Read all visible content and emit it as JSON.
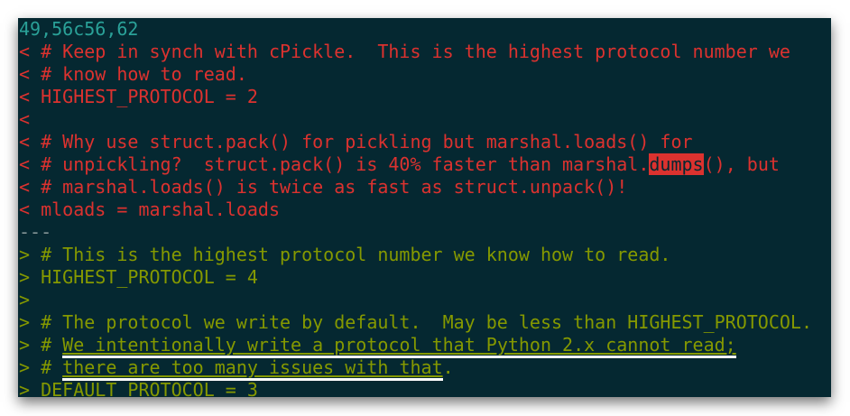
{
  "colors": {
    "background": "#052831",
    "hunk": "#2aa198",
    "deleted": "#dc322f",
    "added": "#859900",
    "separator": "#839496"
  },
  "diff": {
    "hunk_header": "49,56c56,62",
    "deleted": [
      {
        "text": "< # Keep in synch with cPickle.  This is the highest protocol number we"
      },
      {
        "text": "< # know how to read."
      },
      {
        "text": "< HIGHEST_PROTOCOL = 2"
      },
      {
        "text": "<"
      },
      {
        "text": "< # Why use struct.pack() for pickling but marshal.loads() for"
      },
      {
        "pre": "< # unpickling?  struct.pack() is 40% faster than marshal.",
        "highlight": "dumps",
        "post": "(), but"
      },
      {
        "text": "< # marshal.loads() is twice as fast as struct.unpack()!"
      },
      {
        "text": "< mloads = marshal.loads"
      }
    ],
    "separator": "---",
    "added": [
      {
        "text": "> # This is the highest protocol number we know how to read."
      },
      {
        "text": "> HIGHEST_PROTOCOL = 4"
      },
      {
        "text": ">"
      },
      {
        "text": "> # The protocol we write by default.  May be less than HIGHEST_PROTOCOL."
      },
      {
        "pre": "> # ",
        "underlined": "We intentionally write a protocol that Python 2.x cannot read;",
        "post": ""
      },
      {
        "pre": "> # ",
        "underlined": "there are too many issues with that",
        "post": "."
      },
      {
        "text": "> DEFAULT_PROTOCOL = 3"
      }
    ]
  }
}
